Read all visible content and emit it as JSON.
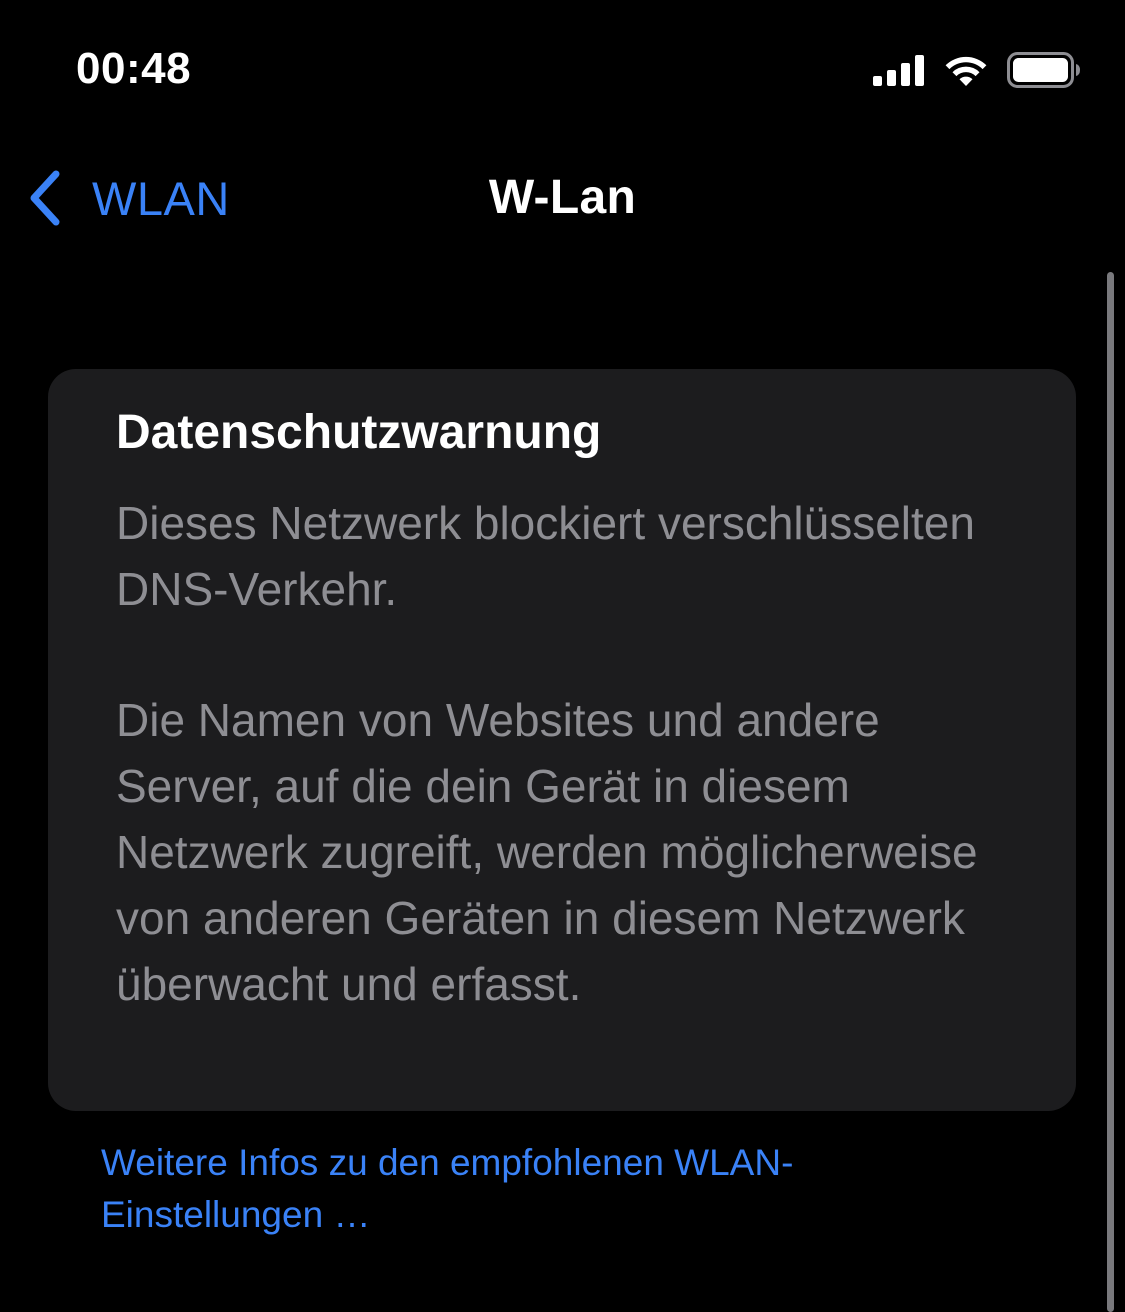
{
  "status_bar": {
    "time": "00:48",
    "icons": [
      "signal-icon",
      "wifi-icon",
      "battery-icon"
    ]
  },
  "nav": {
    "back_label": "WLAN",
    "back_icon": "chevron-left-icon",
    "title": "W-Lan"
  },
  "warning": {
    "title": "Datenschutzwarnung",
    "paragraph_1": "Dieses Netzwerk blockiert verschlüsselten DNS-Verkehr.",
    "paragraph_2": "Die Namen von Websites und andere Server, auf die dein Gerät in diesem Netzwerk zugreift, werden möglicherweise von anderen Geräten in diesem Netzwerk überwacht und erfasst."
  },
  "footer": {
    "more_info_link": "Weitere Infos zu den empfohlenen WLAN-Einstellungen …"
  },
  "colors": {
    "background": "#000000",
    "card": "#1c1c1e",
    "accent": "#3a82f7",
    "secondary_text": "#8e8e93",
    "primary_text": "#ffffff"
  }
}
